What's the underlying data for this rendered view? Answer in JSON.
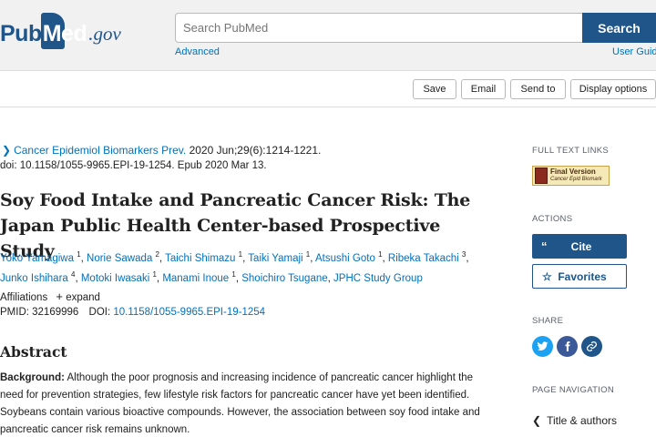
{
  "header": {
    "logo": {
      "part1": "Pub",
      "part2": "Med",
      "part3": ".gov"
    },
    "search_placeholder": "Search PubMed",
    "search_button": "Search",
    "advanced_link": "Advanced",
    "user_guide_link": "User Guide"
  },
  "toolbar": {
    "save": "Save",
    "email": "Email",
    "send_to": "Send to",
    "display_options": "Display options"
  },
  "article": {
    "journal": "Cancer Epidemiol Biomarkers Prev.",
    "citation": " 2020 Jun;29(6):1214-1221.",
    "doi_line": "doi: 10.1158/1055-9965.EPI-19-1254. Epub 2020 Mar 13.",
    "title": "Soy Food Intake and Pancreatic Cancer Risk: The Japan Public Health Center-based Prospective Study",
    "authors": [
      {
        "name": "Yoko Yamagiwa",
        "sup": "1"
      },
      {
        "name": "Norie Sawada",
        "sup": "2"
      },
      {
        "name": "Taichi Shimazu",
        "sup": "1"
      },
      {
        "name": "Taiki Yamaji",
        "sup": "1"
      },
      {
        "name": "Atsushi Goto",
        "sup": "1"
      },
      {
        "name": "Ribeka Takachi",
        "sup": "3"
      },
      {
        "name": "Junko Ishihara",
        "sup": "4"
      },
      {
        "name": "Motoki Iwasaki",
        "sup": "1"
      },
      {
        "name": "Manami Inoue",
        "sup": "1"
      },
      {
        "name": "Shoichiro Tsugane",
        "sup": ""
      },
      {
        "name": "JPHC Study Group",
        "sup": ""
      }
    ],
    "affiliations_label": "Affiliations",
    "expand_label": "expand",
    "pmid_label": "PMID: 32169996",
    "doi_label": "DOI: ",
    "doi_value": "10.1158/1055-9965.EPI-19-1254",
    "abstract_heading": "Abstract",
    "background_label": "Background:",
    "background_text": " Although the poor prognosis and increasing incidence of pancreatic cancer highlight the need for prevention strategies, few lifestyle risk factors for pancreatic cancer have yet been identified. Soybeans contain various bioactive compounds. However, the association between soy food intake and pancreatic cancer risk remains unknown."
  },
  "sidebar": {
    "full_text_links_label": "FULL TEXT LINKS",
    "badge_line1": "Final Version",
    "badge_line2": "Cancer Epid Biomark",
    "actions_label": "ACTIONS",
    "cite_button": "Cite",
    "favorites_button": "Favorites",
    "share_label": "SHARE",
    "page_navigation_label": "PAGE NAVIGATION",
    "nav_title_authors": "Title & authors"
  },
  "colors": {
    "brand": "#20558a",
    "link": "#0071bc",
    "twitter": "#1da1f2",
    "facebook": "#3b5998",
    "permalink": "#20558a"
  }
}
